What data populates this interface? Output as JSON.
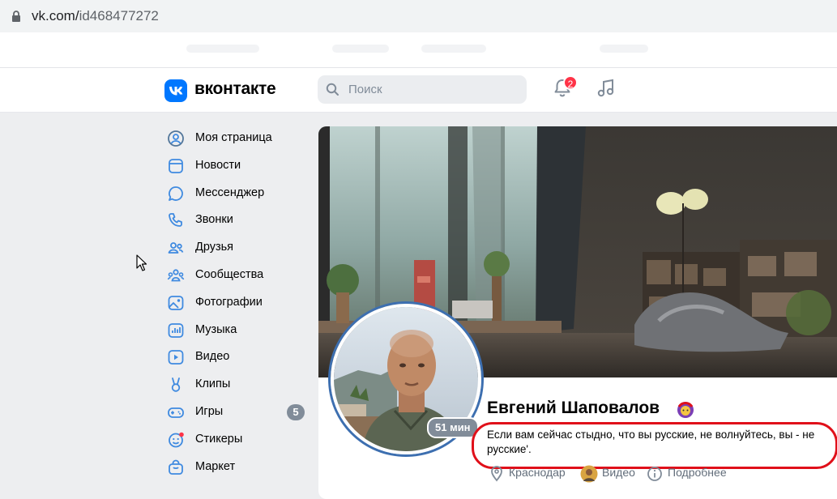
{
  "browser": {
    "url_host": "vk.com/",
    "url_path": "id468477272"
  },
  "header": {
    "logo_text": "вконтакте",
    "search_placeholder": "Поиск",
    "notifications_count": "2"
  },
  "sidebar": {
    "items": [
      {
        "label": "Моя страница",
        "icon": "user-circle-icon"
      },
      {
        "label": "Новости",
        "icon": "newsfeed-icon"
      },
      {
        "label": "Мессенджер",
        "icon": "message-icon"
      },
      {
        "label": "Звонки",
        "icon": "phone-icon"
      },
      {
        "label": "Друзья",
        "icon": "friends-icon"
      },
      {
        "label": "Сообщества",
        "icon": "communities-icon"
      },
      {
        "label": "Фотографии",
        "icon": "photo-icon"
      },
      {
        "label": "Музыка",
        "icon": "music-icon"
      },
      {
        "label": "Видео",
        "icon": "video-icon"
      },
      {
        "label": "Клипы",
        "icon": "clips-icon"
      },
      {
        "label": "Игры",
        "icon": "games-icon",
        "count": "5"
      },
      {
        "label": "Стикеры",
        "icon": "stickers-icon"
      },
      {
        "label": "Маркет",
        "icon": "market-icon"
      }
    ]
  },
  "profile": {
    "name": "Евгений Шаповалов",
    "online": "51 мин",
    "status": "Если вам сейчас стыдно, что вы русские, не волнуйтесь, вы - не русские'.",
    "city": "Краснодар",
    "video_label": "Видео",
    "more_label": "Подробнее"
  },
  "colors": {
    "accent": "#0077ff",
    "badge": "#ff3347",
    "annotation": "#e0101a"
  }
}
